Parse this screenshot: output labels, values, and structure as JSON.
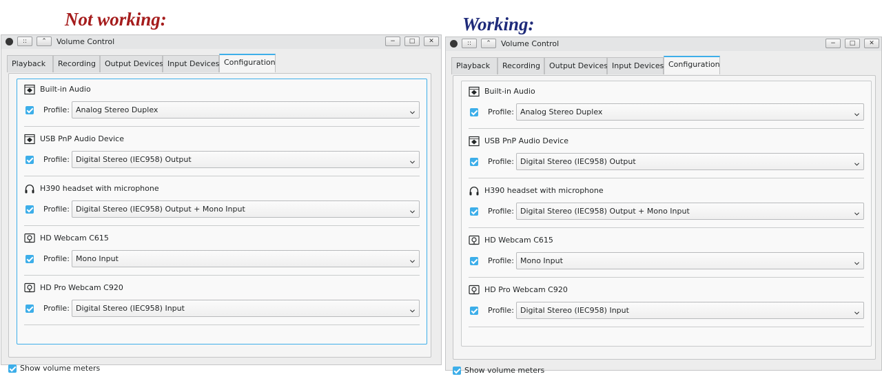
{
  "labels": {
    "not_working": "Not working:",
    "working": "Working:"
  },
  "colors": {
    "not_working_heading": "#a51c1c",
    "working_heading": "#1f2b7a",
    "accent": "#3daee9"
  },
  "window": {
    "title": "Volume Control",
    "titlebar_buttons": {
      "menu": "::",
      "keep_above": "⌃",
      "minimize": "−",
      "maximize": "□",
      "close": "✕"
    },
    "tabs": [
      "Playback",
      "Recording",
      "Output Devices",
      "Input Devices",
      "Configuration"
    ],
    "active_tab": "Configuration",
    "profile_label": "Profile:",
    "devices": [
      {
        "name": "Built-in Audio",
        "icon": "sound-card-icon",
        "enabled": true,
        "profile": "Analog Stereo Duplex"
      },
      {
        "name": "USB PnP Audio Device",
        "icon": "sound-card-icon",
        "enabled": true,
        "profile": "Digital Stereo (IEC958) Output"
      },
      {
        "name": "H390 headset with microphone",
        "icon": "headset-icon",
        "enabled": true,
        "profile": "Digital Stereo (IEC958) Output + Mono Input"
      },
      {
        "name": "HD Webcam C615",
        "icon": "webcam-icon",
        "enabled": true,
        "profile": "Mono Input"
      },
      {
        "name": "HD Pro Webcam C920",
        "icon": "webcam-icon",
        "enabled": true,
        "profile": "Digital Stereo (IEC958) Input"
      }
    ],
    "show_volume_meters_label": "Show volume meters",
    "show_volume_meters": true
  }
}
